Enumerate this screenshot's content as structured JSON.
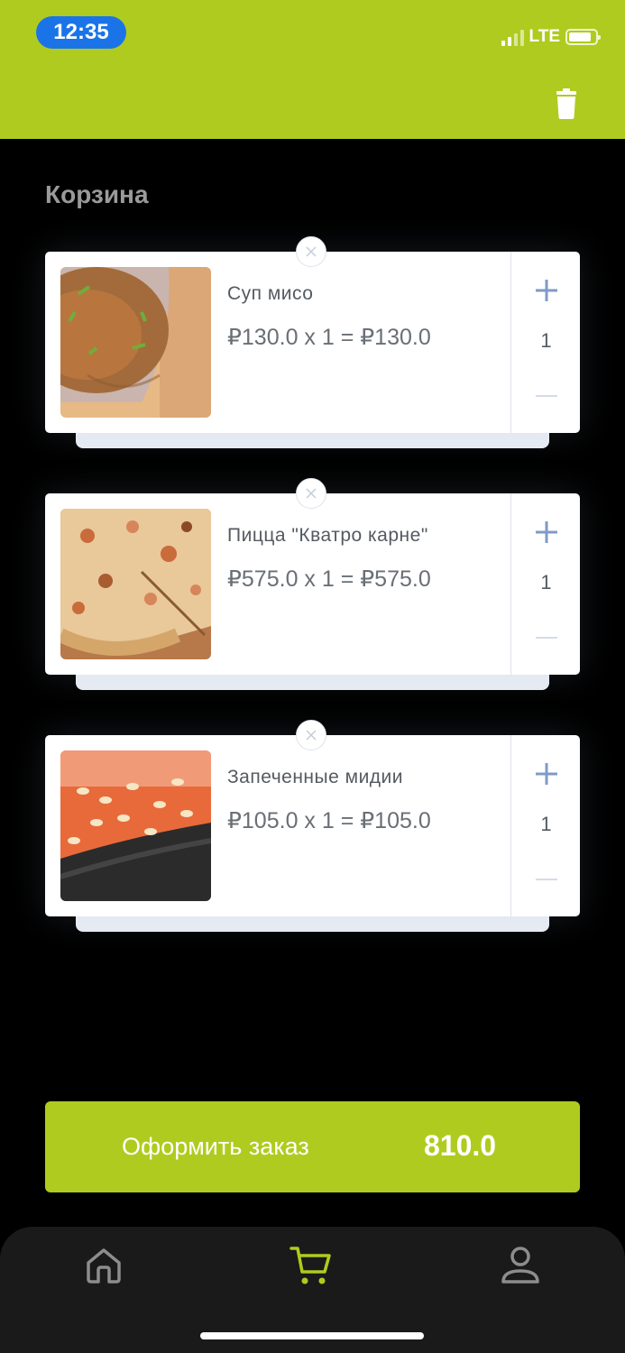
{
  "status_bar": {
    "time": "12:35",
    "network": "LTE"
  },
  "header": {
    "delete_all_icon": "trash-icon"
  },
  "cart": {
    "title": "Корзина",
    "items": [
      {
        "name": "Суп мисо",
        "price_line": "₽130.0 x 1 = ₽130.0",
        "quantity": "1",
        "image": "miso-soup"
      },
      {
        "name": "Пицца \"Кватро карне\"",
        "price_line": "₽575.0 x 1 = ₽575.0",
        "quantity": "1",
        "image": "pizza"
      },
      {
        "name": "Запеченные мидии",
        "price_line": "₽105.0 x 1 = ₽105.0",
        "quantity": "1",
        "image": "baked-mussels"
      }
    ]
  },
  "checkout": {
    "label": "Оформить заказ",
    "total": "810.0"
  },
  "tabbar": {
    "tabs": [
      {
        "name": "home",
        "icon": "home-icon",
        "active": false
      },
      {
        "name": "cart",
        "icon": "cart-icon",
        "active": true
      },
      {
        "name": "profile",
        "icon": "user-icon",
        "active": false
      }
    ]
  },
  "colors": {
    "accent": "#b0cb1f",
    "background": "#000000",
    "card": "#ffffff",
    "time_pill": "#1a74e8"
  }
}
